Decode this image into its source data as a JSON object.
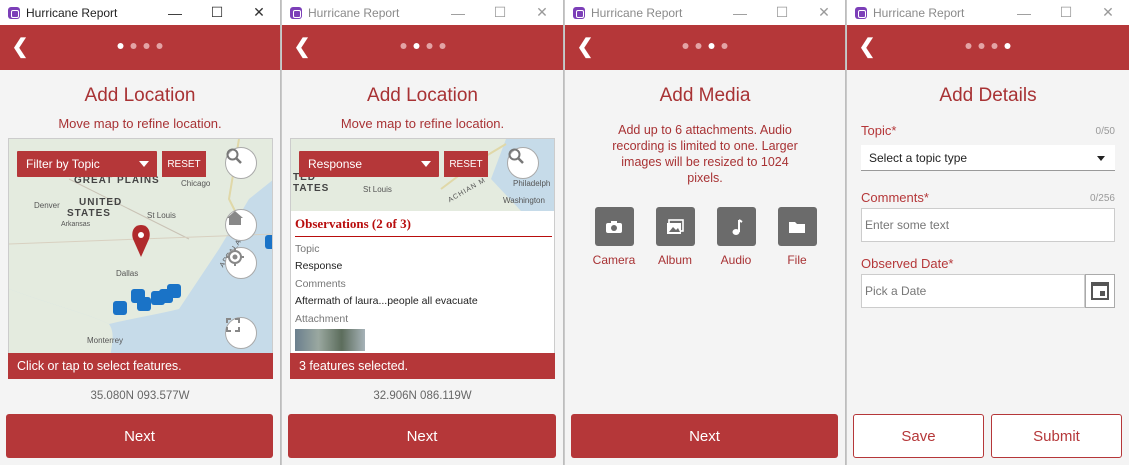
{
  "app_title": "Hurricane Report",
  "window_buttons": {
    "minimize": "—",
    "maximize": "☐",
    "close": "✕"
  },
  "accent_color": "#b53739",
  "screens": [
    {
      "title": "Add Location",
      "subtitle": "Move map to refine location.",
      "filter_label": "Filter by Topic",
      "reset_label": "RESET",
      "map_labels": {
        "great_plains": "GREAT PLAINS",
        "united": "UNITED",
        "states": "STATES",
        "denver": "Denver",
        "chicago": "Chicago",
        "st_louis": "St Louis",
        "dallas": "Dallas",
        "monterrey": "Monterrey",
        "arkansas": "Arkansas",
        "appalachian": "APPALACHIAN"
      },
      "status": "Click or tap to select features.",
      "coords": "35.080N 093.577W",
      "next_label": "Next"
    },
    {
      "title": "Add Location",
      "subtitle": "Move map to refine location.",
      "filter_label": "Response",
      "reset_label": "RESET",
      "map_labels": {
        "ted": "TED",
        "tates": "TATES",
        "st_louis": "St Louis",
        "philadelphia": "Philadelph",
        "washington": "Washington",
        "appalachian": "ACHIAN M"
      },
      "popup": {
        "title": "Observations (2 of 3)",
        "topic_label": "Topic",
        "topic_value": "Response",
        "comments_label": "Comments",
        "comments_value": "Aftermath of laura...people all evacuate",
        "attachment_label": "Attachment"
      },
      "status": "3 features selected.",
      "coords": "32.906N 086.119W",
      "next_label": "Next"
    },
    {
      "title": "Add Media",
      "description": "Add up to 6 attachments. Audio recording is limited to one. Larger images will be resized to 1024 pixels.",
      "media": [
        {
          "label": "Camera",
          "icon": "camera-icon"
        },
        {
          "label": "Album",
          "icon": "album-icon"
        },
        {
          "label": "Audio",
          "icon": "audio-icon"
        },
        {
          "label": "File",
          "icon": "folder-icon"
        }
      ],
      "next_label": "Next"
    },
    {
      "title": "Add Details",
      "topic_label": "Topic*",
      "topic_counter": "0/50",
      "topic_placeholder": "Select a topic type",
      "comments_label": "Comments*",
      "comments_counter": "0/256",
      "comments_placeholder": "Enter some text",
      "date_label": "Observed Date*",
      "date_placeholder": "Pick a Date",
      "save_label": "Save",
      "submit_label": "Submit"
    }
  ]
}
